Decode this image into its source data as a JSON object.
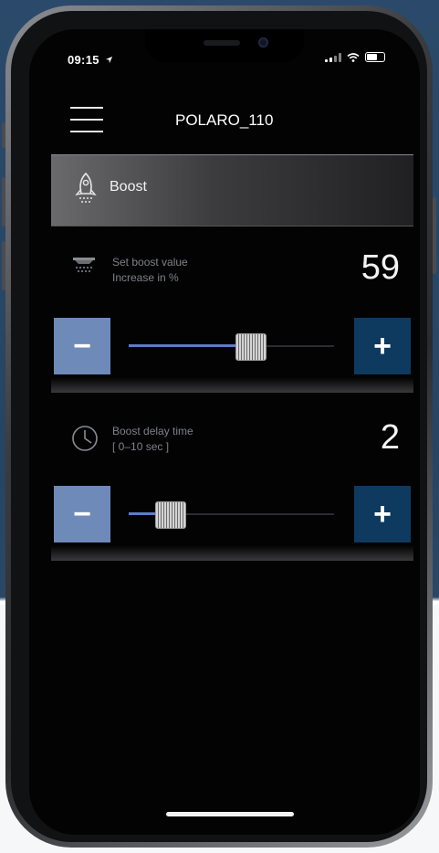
{
  "status_bar": {
    "time": "09:15"
  },
  "header": {
    "title": "POLARO_110"
  },
  "boost_tab": {
    "label": "Boost",
    "icon": "rocket-icon"
  },
  "boost_value": {
    "label_line1": "Set boost value",
    "label_line2": "Increase in %",
    "value": "59",
    "slider_fraction": 0.59,
    "minus_label": "−",
    "plus_label": "+"
  },
  "boost_delay": {
    "label_line1": "Boost delay time",
    "label_line2": "[ 0–10 sec ]",
    "value": "2",
    "slider_fraction": 0.2,
    "minus_label": "−",
    "plus_label": "+"
  },
  "colors": {
    "minus_button": "#6e8ab8",
    "plus_button": "#0f3a5f",
    "slider_fill": "#5c7ec4",
    "background_top": "#2b4a6b"
  }
}
